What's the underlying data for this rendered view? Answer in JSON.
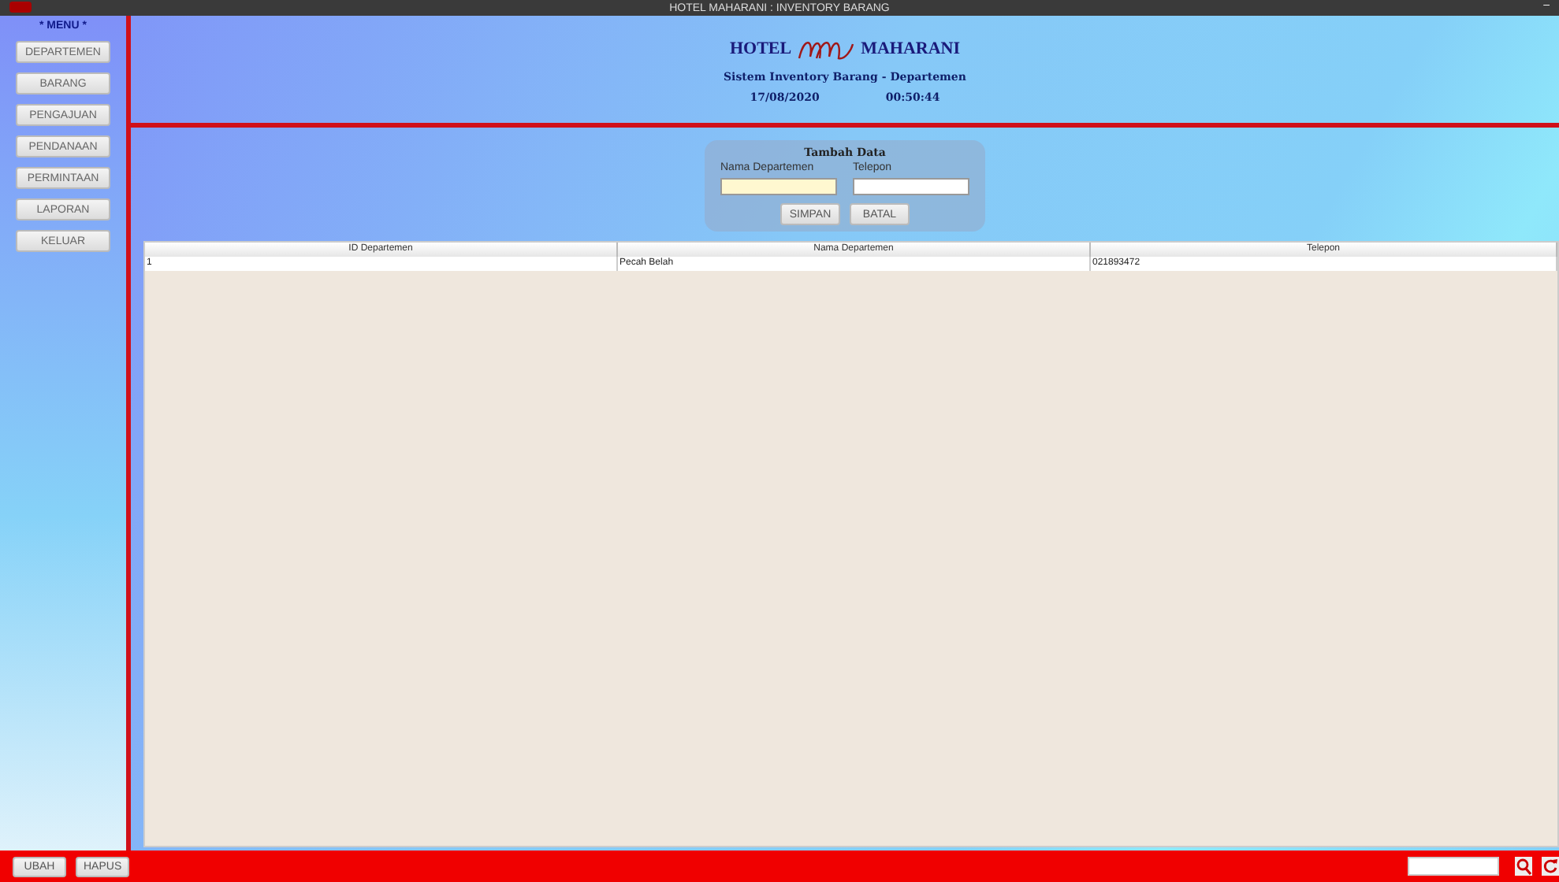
{
  "window": {
    "title": "HOTEL MAHARANI : INVENTORY BARANG",
    "minimize": "–"
  },
  "sidebar": {
    "title": "* MENU *",
    "items": [
      {
        "label": "DEPARTEMEN"
      },
      {
        "label": "BARANG"
      },
      {
        "label": "PENGAJUAN"
      },
      {
        "label": "PENDANAAN"
      },
      {
        "label": "PERMINTAAN"
      },
      {
        "label": "LAPORAN"
      },
      {
        "label": "KELUAR"
      }
    ]
  },
  "header": {
    "logo_left": "HOTEL",
    "logo_right": "MAHARANI",
    "subtitle": "Sistem Inventory Barang - Departemen",
    "date": "17/08/2020",
    "time": "00:50:44"
  },
  "form": {
    "title": "Tambah Data",
    "fields": [
      {
        "label": "Nama Departemen",
        "focused": true
      },
      {
        "label": "Telepon",
        "focused": false
      }
    ],
    "buttons": [
      "SIMPAN",
      "BATAL"
    ]
  },
  "table": {
    "columns": [
      "ID Departemen",
      "Nama Departemen",
      "Telepon"
    ],
    "rows": [
      [
        "1",
        "Pecah Belah",
        "021893472"
      ]
    ]
  },
  "footer": {
    "buttons": [
      "UBAH",
      "HAPUS"
    ]
  }
}
